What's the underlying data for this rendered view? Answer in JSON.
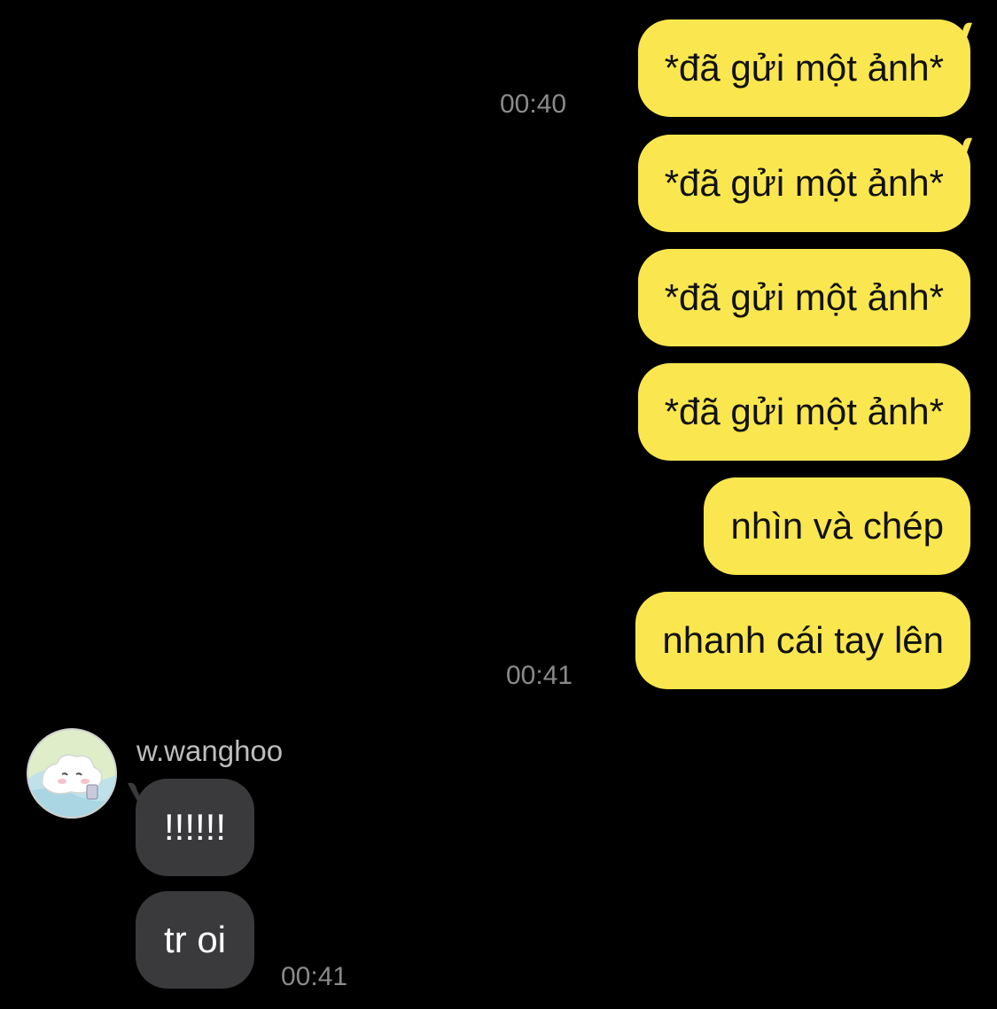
{
  "colors": {
    "background": "#000000",
    "outgoing_bubble": "#fae74f",
    "incoming_bubble": "#3a3a3c",
    "timestamp": "#8a8a8a",
    "sender_name": "#bdbdbd"
  },
  "outgoing": [
    {
      "text": "*đã gửi một ảnh*"
    },
    {
      "text": "*đã gửi một ảnh*"
    },
    {
      "text": "*đã gửi một ảnh*"
    },
    {
      "text": "*đã gửi một ảnh*"
    },
    {
      "text": "nhìn và chép"
    },
    {
      "text": "nhanh cái tay lên"
    }
  ],
  "outgoing_timestamps": [
    "00:40",
    "00:41"
  ],
  "incoming": {
    "sender": "w.wanghoo",
    "avatar_icon": "cartoon-avatar-icon",
    "messages": [
      {
        "text": "!!!!!!"
      },
      {
        "text": "tr oi"
      }
    ],
    "timestamp": "00:41"
  }
}
